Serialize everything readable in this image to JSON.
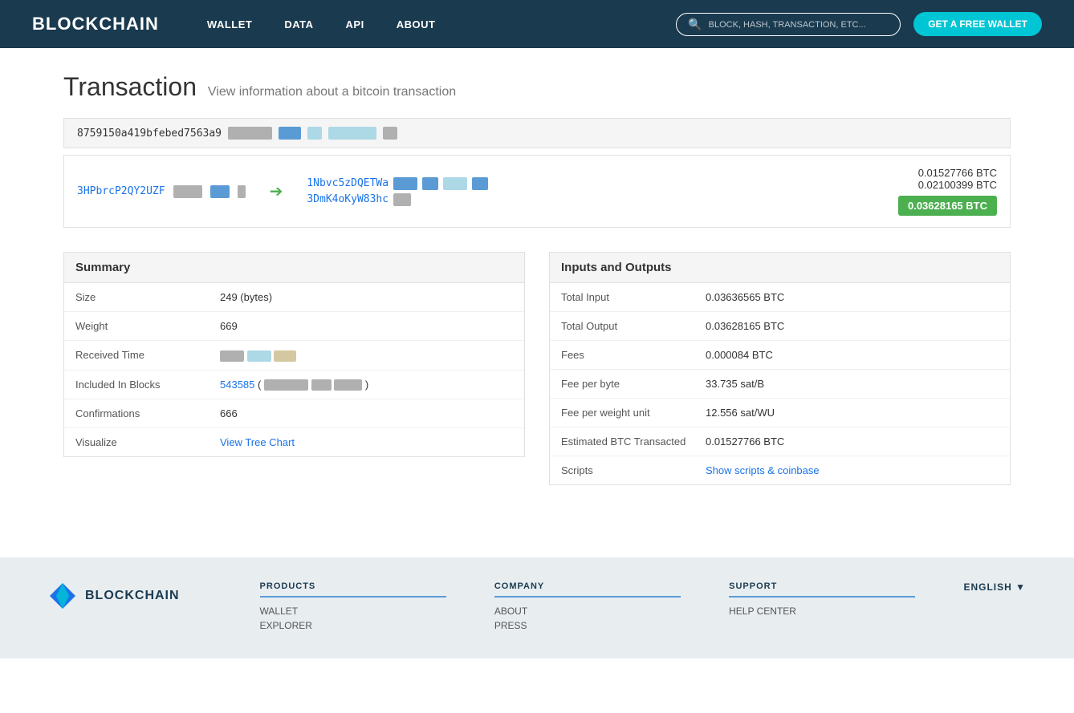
{
  "header": {
    "logo": "BLOCKCHAIN",
    "nav": [
      {
        "label": "WALLET",
        "href": "#"
      },
      {
        "label": "DATA",
        "href": "#"
      },
      {
        "label": "API",
        "href": "#"
      },
      {
        "label": "ABOUT",
        "href": "#"
      }
    ],
    "search_placeholder": "BLOCK, HASH, TRANSACTION, ETC...",
    "cta_button": "GET A FREE WALLET"
  },
  "page": {
    "title": "Transaction",
    "subtitle": "View information about a bitcoin transaction"
  },
  "transaction": {
    "hash_prefix": "8759150a419bfebed7563a9",
    "input_address": "3HPbrcP2QY2UZF",
    "output_addresses": [
      "1Nbvc5zDQETWa",
      "3DmK4oKyW83hc"
    ],
    "amount_1": "0.01527766 BTC",
    "amount_2": "0.02100399 BTC",
    "total_badge": "0.03628165 BTC"
  },
  "summary": {
    "title": "Summary",
    "rows": [
      {
        "label": "Size",
        "value": "249 (bytes)"
      },
      {
        "label": "Weight",
        "value": "669"
      },
      {
        "label": "Received Time",
        "value": ""
      },
      {
        "label": "Included In Blocks",
        "value": "543585"
      },
      {
        "label": "Confirmations",
        "value": "666"
      },
      {
        "label": "Visualize",
        "value": "View Tree Chart"
      }
    ]
  },
  "inputs_outputs": {
    "title": "Inputs and Outputs",
    "rows": [
      {
        "label": "Total Input",
        "value": "0.03636565 BTC"
      },
      {
        "label": "Total Output",
        "value": "0.03628165 BTC"
      },
      {
        "label": "Fees",
        "value": "0.000084 BTC"
      },
      {
        "label": "Fee per byte",
        "value": "33.735 sat/B"
      },
      {
        "label": "Fee per weight unit",
        "value": "12.556 sat/WU"
      },
      {
        "label": "Estimated BTC Transacted",
        "value": "0.01527766 BTC"
      },
      {
        "label": "Scripts",
        "value": "Show scripts & coinbase"
      }
    ]
  },
  "footer": {
    "logo": "BLOCKCHAIN",
    "columns": [
      {
        "title": "PRODUCTS",
        "links": [
          "WALLET",
          "EXPLORER"
        ]
      },
      {
        "title": "COMPANY",
        "links": [
          "ABOUT",
          "PRESS"
        ]
      },
      {
        "title": "SUPPORT",
        "links": [
          "HELP CENTER"
        ]
      }
    ],
    "language": "ENGLISH"
  }
}
